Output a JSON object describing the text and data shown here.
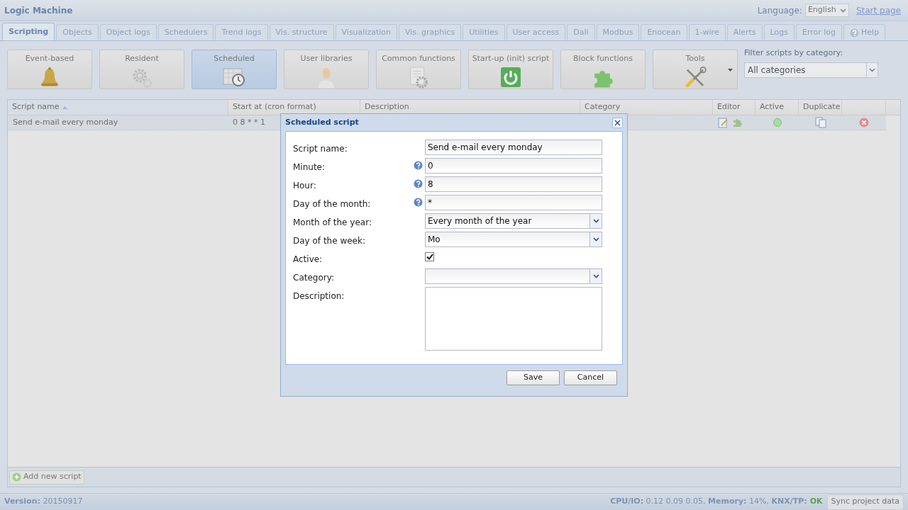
{
  "header": {
    "title": "Logic Machine",
    "language_label": "Language:",
    "language_value": "English",
    "start_page": "Start page"
  },
  "tabs": [
    {
      "label": "Scripting",
      "selected": true
    },
    {
      "label": "Objects",
      "selected": false
    },
    {
      "label": "Object logs",
      "selected": false
    },
    {
      "label": "Schedulers",
      "selected": false
    },
    {
      "label": "Trend logs",
      "selected": false
    },
    {
      "label": "Vis. structure",
      "selected": false
    },
    {
      "label": "Visualization",
      "selected": false
    },
    {
      "label": "Vis. graphics",
      "selected": false
    },
    {
      "label": "Utilities",
      "selected": false
    },
    {
      "label": "User access",
      "selected": false
    },
    {
      "label": "Dali",
      "selected": false
    },
    {
      "label": "Modbus",
      "selected": false
    },
    {
      "label": "Enocean",
      "selected": false
    },
    {
      "label": "1-wire",
      "selected": false
    },
    {
      "label": "Alerts",
      "selected": false
    },
    {
      "label": "Logs",
      "selected": false
    },
    {
      "label": "Error log",
      "selected": false
    },
    {
      "label": "Help",
      "selected": false,
      "kind": "help"
    }
  ],
  "toolbar": [
    {
      "label": "Event-based",
      "selected": false
    },
    {
      "label": "Resident",
      "selected": false
    },
    {
      "label": "Scheduled",
      "selected": true
    },
    {
      "label": "User libraries",
      "selected": false
    },
    {
      "label": "Common functions",
      "selected": false
    },
    {
      "label": "Start-up (init) script",
      "selected": false
    },
    {
      "label": "Block functions",
      "selected": false
    },
    {
      "label": "Tools",
      "selected": false,
      "kind": "menu"
    }
  ],
  "filter": {
    "label": "Filter scripts by category:",
    "value": "All categories"
  },
  "table": {
    "columns": [
      "Script name",
      "Start at (cron format)",
      "Description",
      "Category",
      "Editor",
      "Active",
      "Duplicate"
    ],
    "rows": [
      {
        "name": "Send e-mail every monday",
        "cron": "0 8 * * 1",
        "active": true
      }
    ]
  },
  "add_button": "Add new script",
  "dialog": {
    "title": "Scheduled script",
    "fields": [
      {
        "label": "Script name:",
        "kind": "text",
        "value": "Send e-mail every monday",
        "help": false
      },
      {
        "label": "Minute:",
        "kind": "text",
        "value": "0",
        "help": true
      },
      {
        "label": "Hour:",
        "kind": "text",
        "value": "8",
        "help": true
      },
      {
        "label": "Day of the month:",
        "kind": "text",
        "value": "*",
        "help": true
      },
      {
        "label": "Month of the year:",
        "kind": "select",
        "value": "Every month of the year",
        "help": false
      },
      {
        "label": "Day of the week:",
        "kind": "select",
        "value": "Mo",
        "help": false
      },
      {
        "label": "Active:",
        "kind": "checkbox",
        "checked": true,
        "help": false
      },
      {
        "label": "Category:",
        "kind": "select",
        "help": false
      },
      {
        "label": "Description:",
        "kind": "textarea",
        "help": false
      }
    ],
    "buttons": [
      "Save",
      "Cancel"
    ]
  },
  "status_bar": {
    "version_label": "Version:",
    "version": "20150917",
    "stats": "**CPU/IO:** 0.12 0.09 0.05, **Memory:** 14%, **KNX/TP:**",
    "knx_status": "OK",
    "sync_button": "Sync project data"
  }
}
